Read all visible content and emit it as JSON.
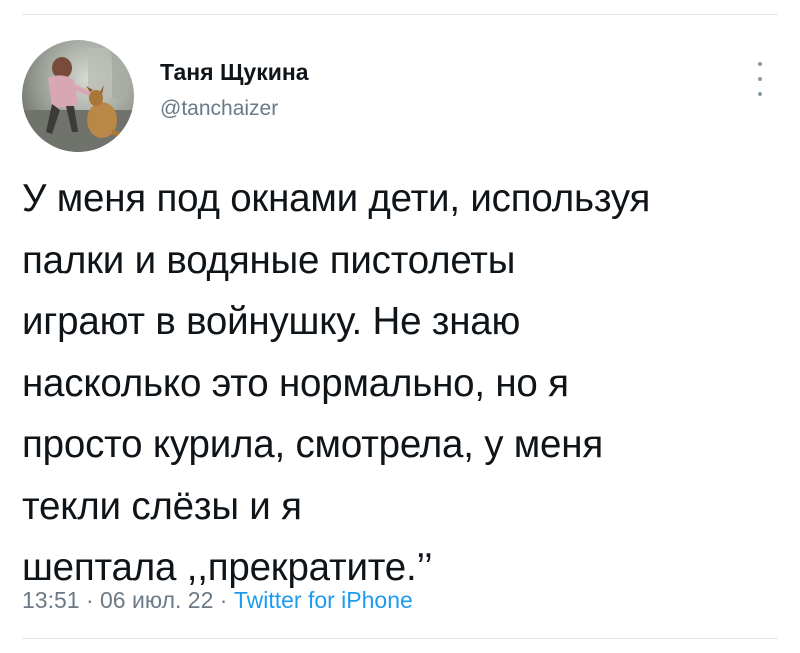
{
  "tweet": {
    "author": {
      "display_name": "Таня Щукина",
      "handle": "@tanchaizer",
      "avatar": "avatar-photo-woman-petting-dog"
    },
    "more_icon": "more-vertical-icon",
    "text": "У меня под окнами дети, используя\nпалки и водяные пистолеты\nиграют в войнушку. Не знаю\nнасколько это нормально, но я\nпросто курила, смотрела, у меня\nтекли слёзы и я\nшептала ,,прекратите.’’",
    "time": "13:51",
    "date": "06 июл. 22",
    "separator": "·",
    "source": "Twitter for iPhone"
  },
  "colors": {
    "text": "#0f1419",
    "secondary": "#6b7a86",
    "link": "#1d9bf0",
    "divider": "#e6e6e6"
  }
}
